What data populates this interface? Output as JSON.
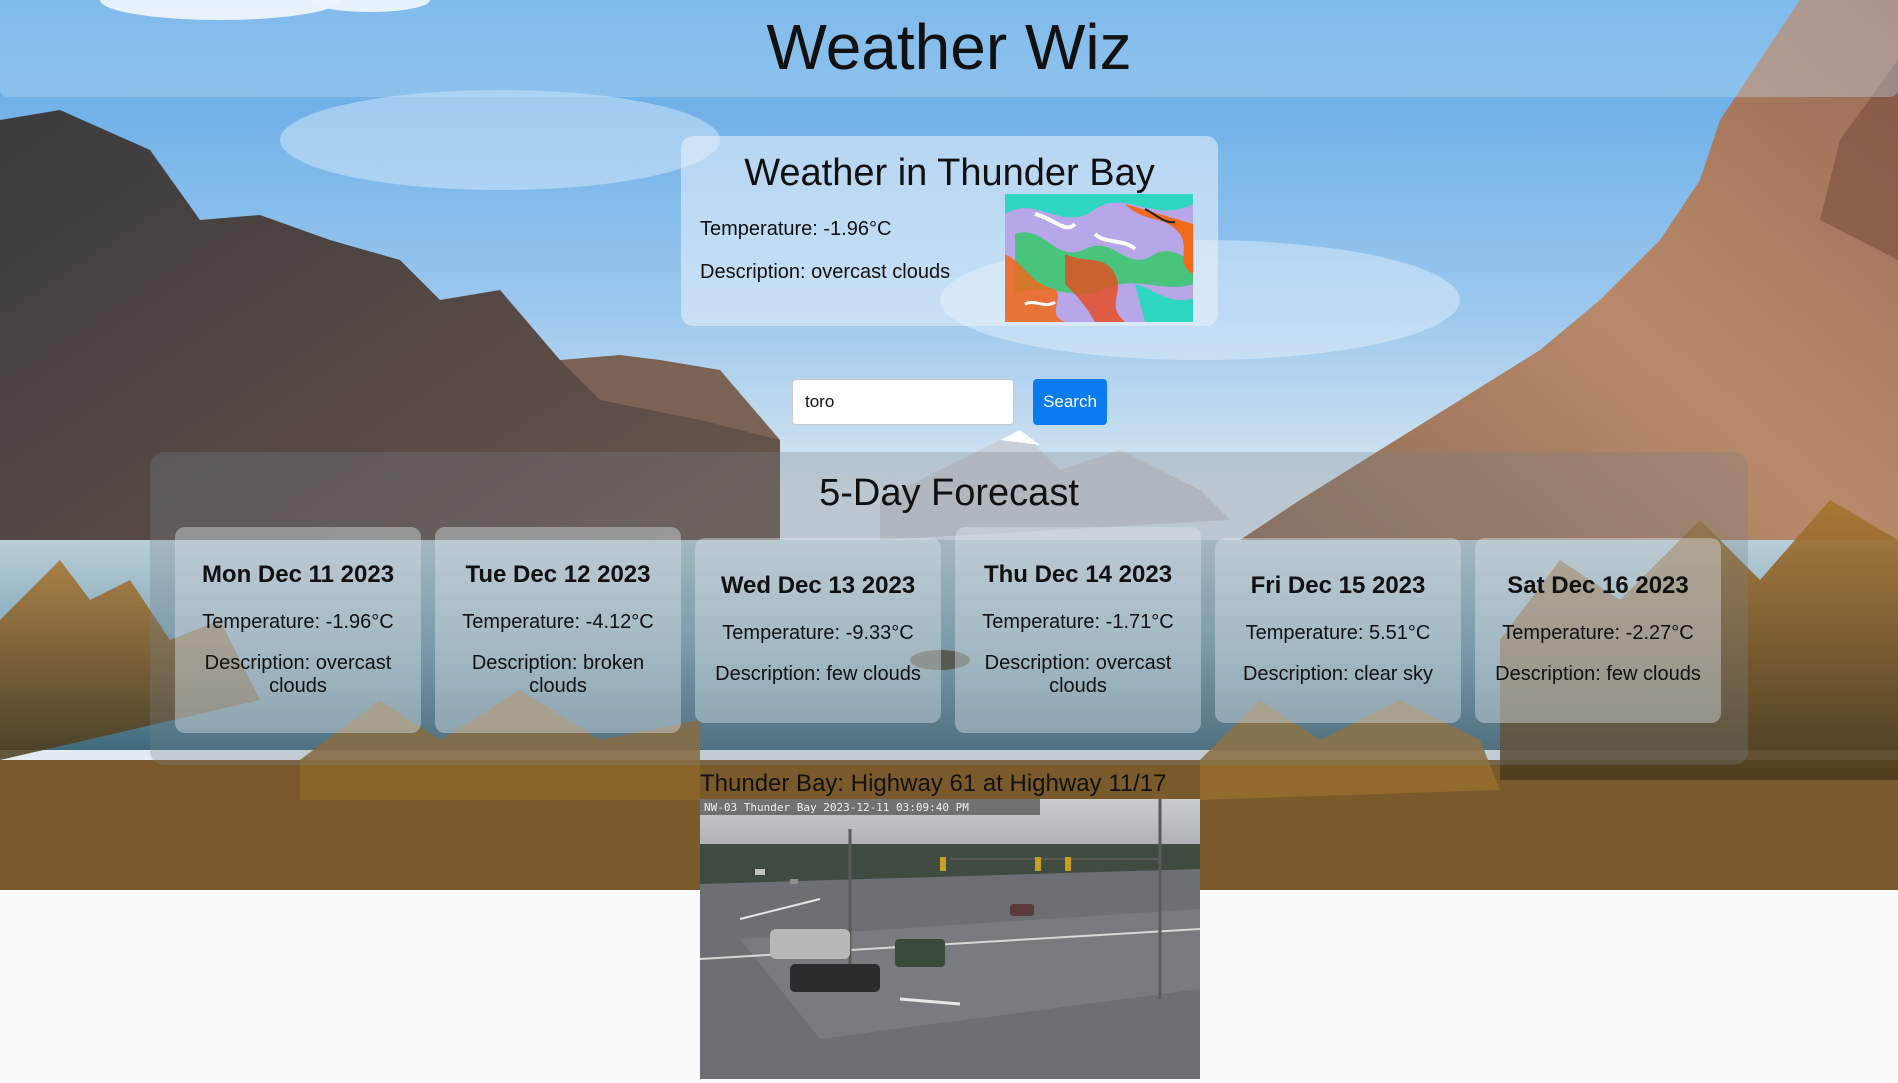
{
  "header": {
    "title": "Weather Wiz"
  },
  "current": {
    "title": "Weather in Thunder Bay",
    "temperature": "Temperature: -1.96°C",
    "description": "Description: overcast clouds"
  },
  "search": {
    "value": "toro",
    "button_label": "Search"
  },
  "forecast": {
    "title": "5-Day Forecast",
    "days": [
      {
        "date": "Mon Dec 11 2023",
        "temperature": "Temperature: -1.96°C",
        "description": "Description: overcast clouds"
      },
      {
        "date": "Tue Dec 12 2023",
        "temperature": "Temperature: -4.12°C",
        "description": "Description: broken clouds"
      },
      {
        "date": "Wed Dec 13 2023",
        "temperature": "Temperature: -9.33°C",
        "description": "Description: few clouds"
      },
      {
        "date": "Thu Dec 14 2023",
        "temperature": "Temperature: -1.71°C",
        "description": "Description: overcast clouds"
      },
      {
        "date": "Fri Dec 15 2023",
        "temperature": "Temperature: 5.51°C",
        "description": "Description: clear sky"
      },
      {
        "date": "Sat Dec 16 2023",
        "temperature": "Temperature: -2.27°C",
        "description": "Description: few clouds"
      }
    ]
  },
  "camera": {
    "caption": "Thunder Bay: Highway 61 at Highway 11/17",
    "overlay_text": "NW-03 Thunder Bay  2023-12-11  03:09:40 PM"
  },
  "colors": {
    "accent": "#0a7bf0",
    "text": "#111111"
  }
}
